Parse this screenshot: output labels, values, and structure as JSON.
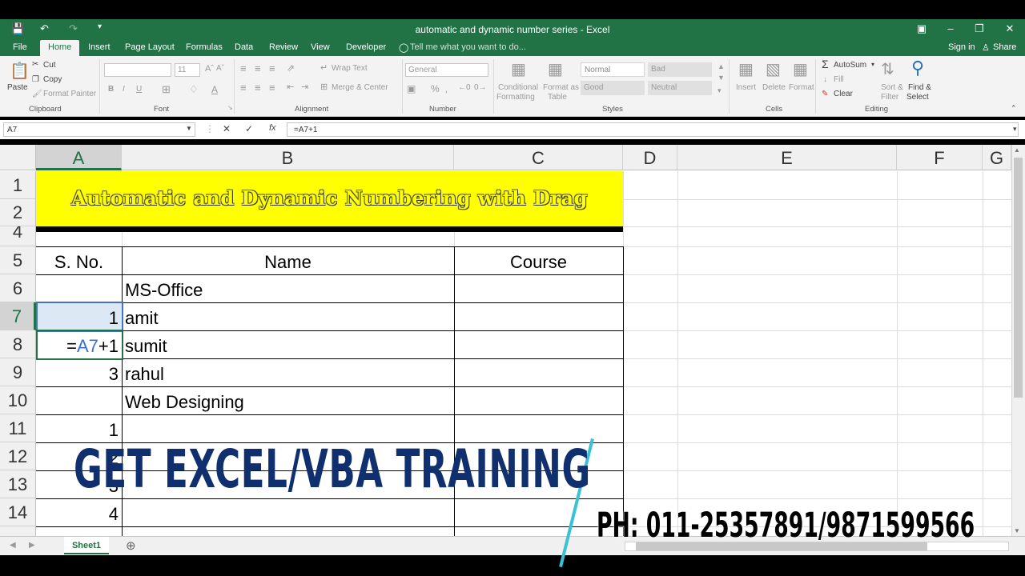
{
  "window": {
    "title": "automatic and dynamic number series - Excel"
  },
  "tabs": [
    "File",
    "Home",
    "Insert",
    "Page Layout",
    "Formulas",
    "Data",
    "Review",
    "View",
    "Developer"
  ],
  "tell_me": "Tell me what you want to do...",
  "account": {
    "sign_in": "Sign in",
    "share": "Share"
  },
  "ribbon": {
    "clipboard": {
      "paste": "Paste",
      "cut": "Cut",
      "copy": "Copy",
      "format_painter": "Format Painter",
      "group": "Clipboard"
    },
    "font": {
      "size": "11",
      "group": "Font"
    },
    "alignment": {
      "wrap_text": "Wrap Text",
      "merge_center": "Merge & Center",
      "group": "Alignment"
    },
    "number": {
      "format": "General",
      "group": "Number"
    },
    "styles": {
      "conditional": "Conditional",
      "formatting": "Formatting",
      "format_as": "Format as",
      "table": "Table",
      "normal": "Normal",
      "bad": "Bad",
      "good": "Good",
      "neutral": "Neutral",
      "group": "Styles"
    },
    "cells": {
      "insert": "Insert",
      "delete": "Delete",
      "format": "Format",
      "group": "Cells"
    },
    "editing": {
      "autosum": "AutoSum",
      "fill": "Fill",
      "clear": "Clear",
      "sort": "Sort &",
      "filter": "Filter",
      "find": "Find &",
      "select": "Select",
      "group": "Editing"
    }
  },
  "formula_bar": {
    "name_box": "A7",
    "formula": "=A7+1"
  },
  "columns": [
    "A",
    "B",
    "C",
    "D",
    "E",
    "F",
    "G"
  ],
  "rows": [
    "1",
    "2",
    "4",
    "5",
    "6",
    "7",
    "8",
    "9",
    "10",
    "11",
    "12",
    "13",
    "14"
  ],
  "sheet": {
    "banner": "Automatic  and Dynamic Numbering with Drag",
    "header": {
      "sno": "S. No.",
      "name": "Name",
      "course": "Course"
    },
    "cells": {
      "b6": "MS-Office",
      "a7": "1",
      "b7": "amit",
      "a8_eq": "=",
      "a8_ref": "A7",
      "a8_tail": "+1",
      "b8": "sumit",
      "a9": "3",
      "b9": "rahul",
      "b10": "Web Designing",
      "a11": "1",
      "a12": "2",
      "a13": "3",
      "a14": "4"
    }
  },
  "sheet_tabs": [
    "Sheet1"
  ],
  "overlay": {
    "promo": "GET EXCEL/VBA TRAINING",
    "phone": "PH: 011-25357891/9871599566"
  },
  "colors": {
    "excel_green": "#217346",
    "banner_yellow": "#ffff00",
    "promo_blue": "#0f2f6e",
    "ref_blue": "#3b6fd1"
  }
}
